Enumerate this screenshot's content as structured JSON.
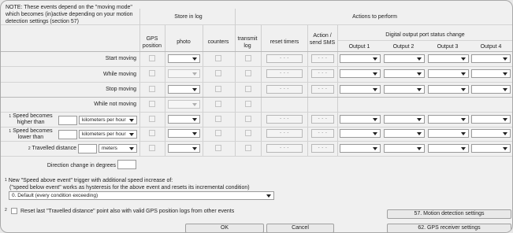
{
  "note": "NOTE: These events depend on the \"moving mode\" which becomes (in)active depending on your motion detection settings (section 57)",
  "headers": {
    "store_in_log": "Store in log",
    "actions_to_perform": "Actions to perform",
    "gps_position": "GPS position",
    "photo": "photo",
    "counters": "counters",
    "transmit_log": "transmit log",
    "reset_timers": "reset timers",
    "action_send_sms": "Action / send SMS",
    "digital_output": "Digital output port status change",
    "output1": "Output 1",
    "output2": "Output 2",
    "output3": "Output 3",
    "output4": "Output 4"
  },
  "rows": {
    "start_moving": "Start moving",
    "while_moving": "While moving",
    "stop_moving": "Stop moving",
    "while_not_moving": "While not moving",
    "speed_higher_sup": "1",
    "speed_higher_label": "Speed becomes higher than",
    "speed_lower_sup": "1",
    "speed_lower_label": "Speed becomes lower than",
    "travelled_sup": "2",
    "travelled_label": "Travelled distance",
    "direction_change": "Direction change in degrees"
  },
  "units": {
    "kmh": "kilometers per hour",
    "meters": "meters"
  },
  "placeholder_dashes": "- - -",
  "footnote1_sup": "1",
  "footnote1_line1": "New \"Speed above event\" trigger with additional speed increase of:",
  "footnote1_line2": "(\"speed below event\" works as hysteresis for the above event and resets its incremental condition)",
  "speed_increase_value": "0. Default (every condition exceeding)",
  "footnote2_sup": "2",
  "footnote2_text": "Reset last \"Travelled distance\" point also with valid GPS position logs from other events",
  "buttons": {
    "ok": "OK",
    "cancel": "Cancel",
    "motion": "57. Motion detection settings",
    "gps": "62. GPS receiver settings"
  }
}
